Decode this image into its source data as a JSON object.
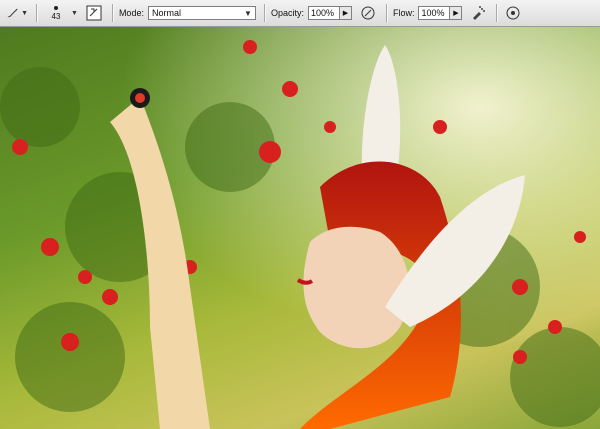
{
  "toolbar": {
    "brush_size": "43",
    "mode_label": "Mode:",
    "mode_value": "Normal",
    "opacity_label": "Opacity:",
    "opacity_value": "100%",
    "flow_label": "Flow:",
    "flow_value": "100%"
  },
  "icons": {
    "tool": "brush-icon",
    "preset_toggle": "brush-panel-toggle-icon",
    "airbrush": "airbrush-icon",
    "tablet_opacity": "tablet-pressure-opacity-icon",
    "tablet_size": "tablet-pressure-size-icon"
  },
  "colors": {
    "toolbar_bg": "#e4e4e4",
    "flower_red": "#d8201f",
    "hair_red": "#e0221b",
    "skin": "#f2d8a8"
  }
}
